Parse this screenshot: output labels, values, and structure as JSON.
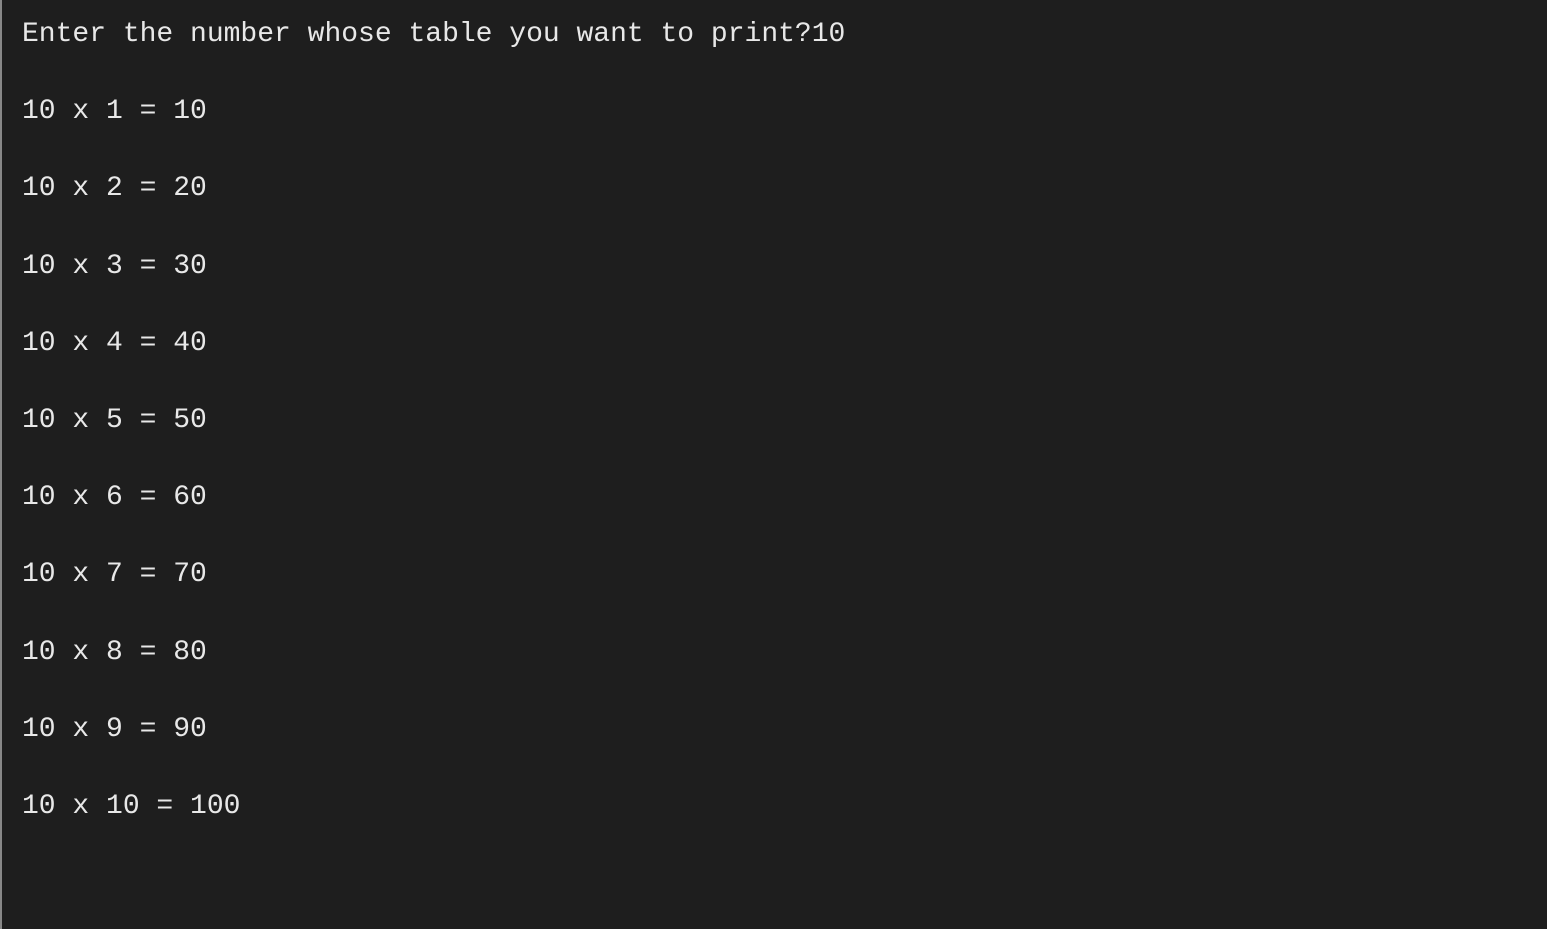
{
  "console": {
    "prompt": "Enter the number whose table you want to print?",
    "input": "10",
    "lines": [
      "10 x 1 = 10",
      "10 x 2 = 20",
      "10 x 3 = 30",
      "10 x 4 = 40",
      "10 x 5 = 50",
      "10 x 6 = 60",
      "10 x 7 = 70",
      "10 x 8 = 80",
      "10 x 9 = 90",
      "10 x 10 = 100"
    ]
  }
}
